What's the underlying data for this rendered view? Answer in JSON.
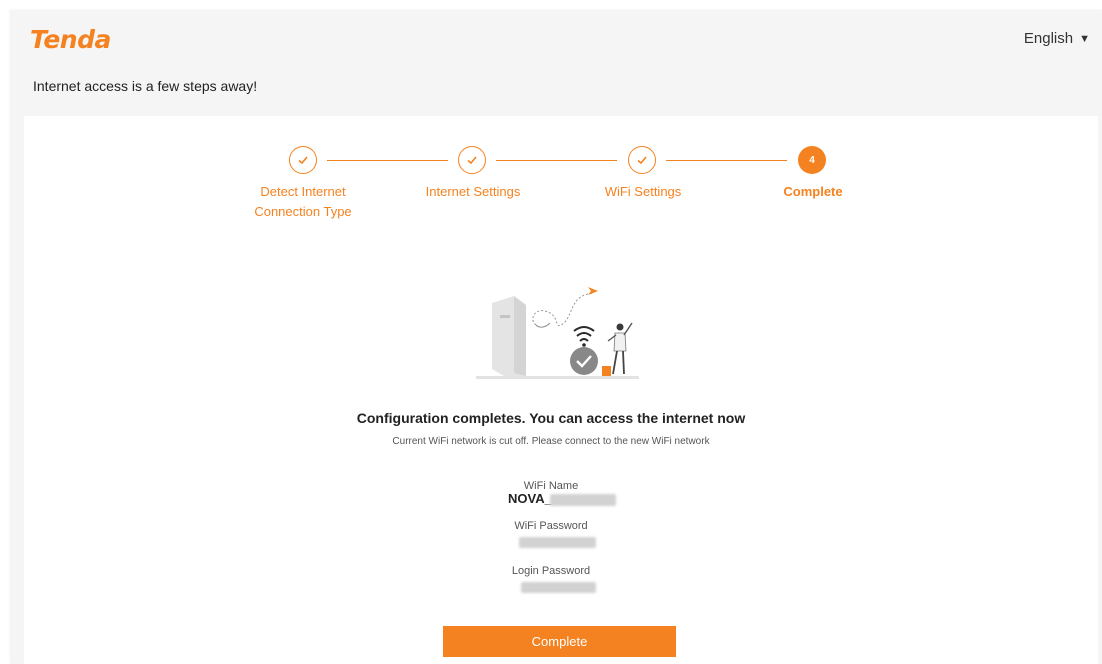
{
  "header": {
    "logo_text": "Tenda",
    "language": "English",
    "subtitle": "Internet access is a few steps away!"
  },
  "steps": [
    {
      "label_line1": "Detect Internet",
      "label_line2": "Connection Type",
      "status": "done"
    },
    {
      "label_line1": "Internet Settings",
      "label_line2": "",
      "status": "done"
    },
    {
      "label_line1": "WiFi Settings",
      "label_line2": "",
      "status": "done"
    },
    {
      "label_line1": "Complete",
      "label_line2": "",
      "status": "current",
      "number": "4"
    }
  ],
  "result": {
    "headline": "Configuration completes. You can access the internet now",
    "note": "Current WiFi network is cut off. Please connect to the new WiFi network",
    "wifi_name_label": "WiFi Name",
    "wifi_name_value": "NOVA_",
    "wifi_password_label": "WiFi Password",
    "login_password_label": "Login Password"
  },
  "actions": {
    "complete_button": "Complete"
  },
  "colors": {
    "accent": "#f58220"
  },
  "icons": [
    "check-circle-icon",
    "caret-down-icon"
  ]
}
